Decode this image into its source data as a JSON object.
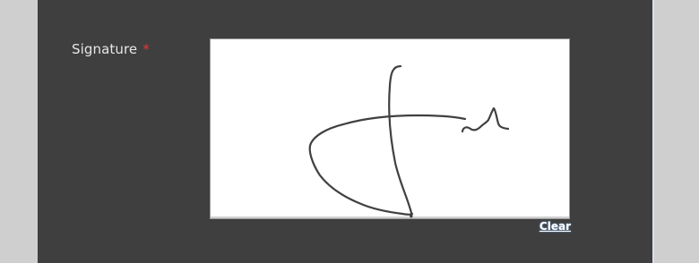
{
  "form": {
    "signature_label": "Signature",
    "required_marker": "*",
    "clear_label": "Clear"
  },
  "colors": {
    "panel_background": "#3f3f3f",
    "page_background": "#cfcfcf",
    "label_text": "#e6e6e6",
    "required": "#e03a3a",
    "ink": "#404040"
  }
}
